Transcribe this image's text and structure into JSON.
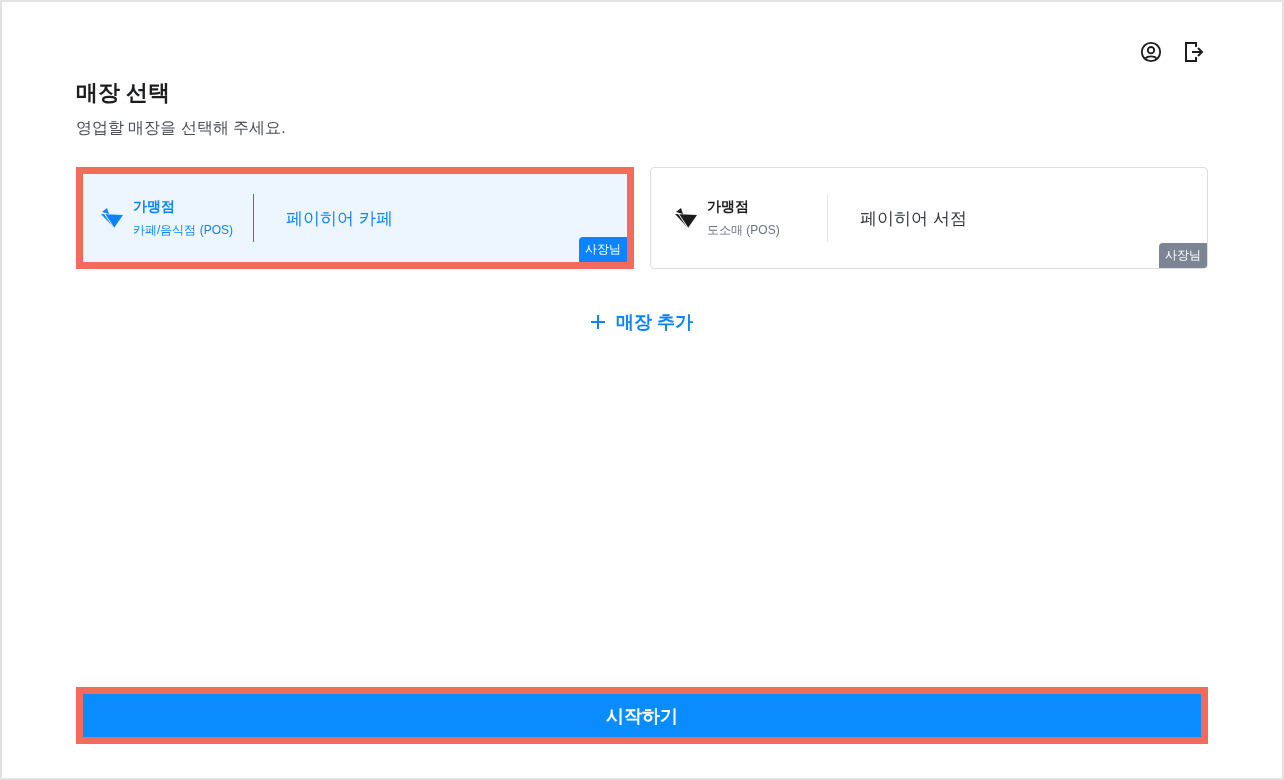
{
  "header": {
    "title": "매장 선택",
    "subtitle": "영업할 매장을 선택해 주세요."
  },
  "stores": [
    {
      "type": "가맹점",
      "category": "카페/음식점 (POS)",
      "name": "페이히어 카페",
      "role": "사장님",
      "selected": true,
      "highlighted": true
    },
    {
      "type": "가맹점",
      "category": "도소매 (POS)",
      "name": "페이히어 서점",
      "role": "사장님",
      "selected": false,
      "highlighted": false
    }
  ],
  "add_store": {
    "label": "매장 추가"
  },
  "start_button": {
    "label": "시작하기",
    "highlighted": true
  }
}
